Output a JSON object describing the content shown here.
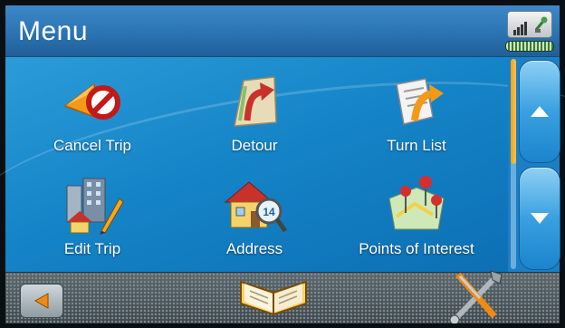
{
  "header": {
    "title": "Menu"
  },
  "menu_items": [
    {
      "label": "Cancel Trip",
      "icon": "cancel-trip-icon"
    },
    {
      "label": "Detour",
      "icon": "detour-icon"
    },
    {
      "label": "Turn List",
      "icon": "turn-list-icon"
    },
    {
      "label": "Edit Trip",
      "icon": "edit-trip-icon"
    },
    {
      "label": "Address",
      "icon": "address-icon"
    },
    {
      "label": "Points of Interest",
      "icon": "points-of-interest-icon"
    }
  ],
  "address_icon_number": "14",
  "scroll": {
    "thumb_fraction": 0.5
  },
  "colors": {
    "header": "#2d76b6",
    "content": "#1585c8",
    "scroll_thumb": "#f2a21a",
    "footer": "#4a5458"
  }
}
